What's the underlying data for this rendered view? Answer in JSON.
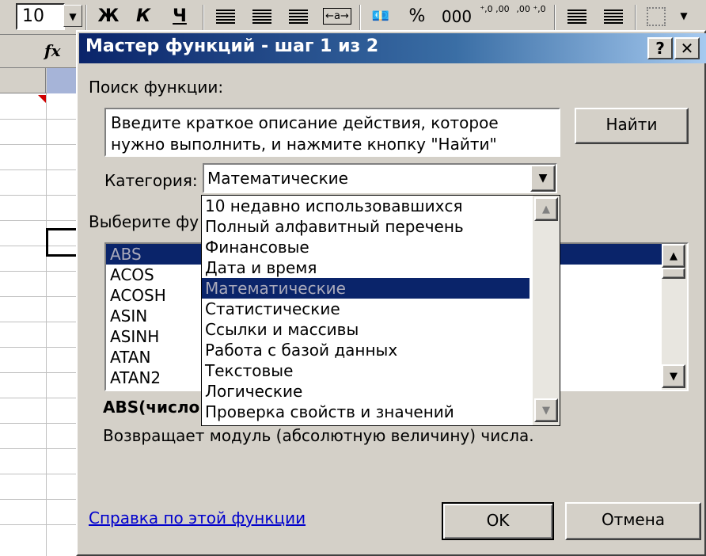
{
  "toolbar": {
    "font_size": "10",
    "bold_label": "Ж",
    "italic_label": "К",
    "underline_label": "Ч",
    "merge_label": "←a→",
    "percent_label": "%",
    "thousands_label": "000",
    "inc_decimal_label": "⁺,0 ,00",
    "dec_decimal_label": ",00 ⁺,0"
  },
  "formula_bar": {
    "fx_label": "fx"
  },
  "dialog": {
    "title": "Мастер функций - шаг 1 из 2",
    "help_button": "?",
    "close_button": "✕",
    "search_label": "Поиск функции:",
    "search_text": "Введите краткое описание действия, которое нужно выполнить, и нажмите кнопку \"Найти\"",
    "find_button": "Найти",
    "category_label": "Категория:",
    "category_value": "Математические",
    "select_function_label": "Выберите фу",
    "functions": [
      "ABS",
      "ACOS",
      "ACOSH",
      "ASIN",
      "ASINH",
      "ATAN",
      "ATAN2"
    ],
    "selected_function": "ABS",
    "signature": "ABS(число",
    "description": "Возвращает модуль (абсолютную величину) числа.",
    "help_link": "Справка по этой функции",
    "ok_button": "OK",
    "cancel_button": "Отмена"
  },
  "category_dropdown": {
    "items": [
      "10 недавно использовавшихся",
      "Полный алфавитный перечень",
      "Финансовые",
      "Дата и время",
      "Математические",
      "Статистические",
      "Ссылки и массивы",
      "Работа с базой данных",
      "Текстовые",
      "Логические",
      "Проверка свойств и значений"
    ],
    "selected": "Математические"
  },
  "colors": {
    "title_bar": "#0a246a",
    "selection": "#0a246a",
    "link": "#0000cc",
    "face": "#d4d0c8"
  }
}
